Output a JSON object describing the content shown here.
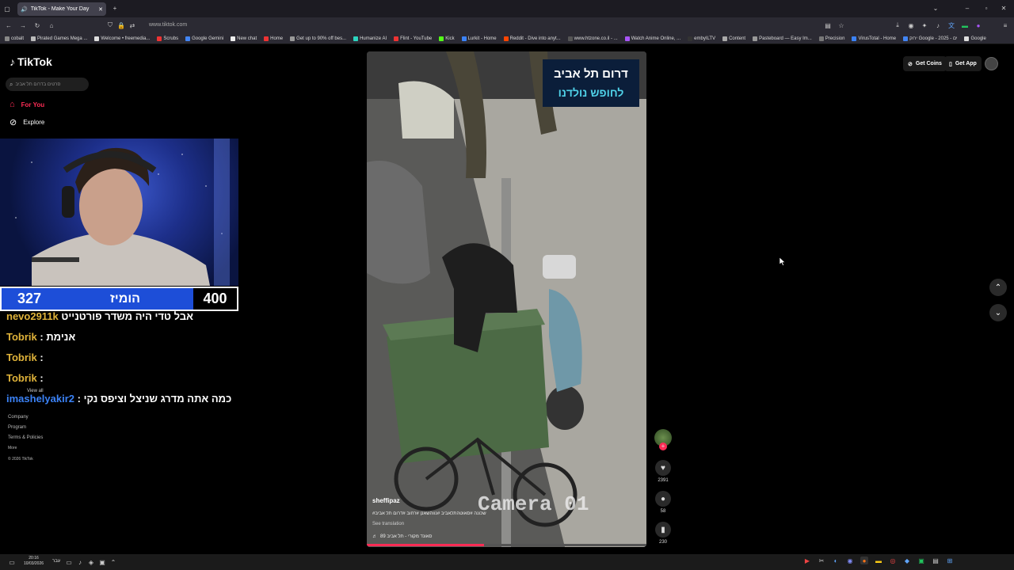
{
  "browser": {
    "tab_title": "TikTok - Make Your Day",
    "url": "www.tiktok.com",
    "bookmarks": [
      {
        "label": "cobalt",
        "color": "#888888"
      },
      {
        "label": "Pirated Games Mega ...",
        "color": "#bbbbbb"
      },
      {
        "label": "Welcome • freemedia...",
        "color": "#dddddd"
      },
      {
        "label": "Scrubs",
        "color": "#e33"
      },
      {
        "label": "Google Gemini",
        "color": "#4285f4"
      },
      {
        "label": "New chat",
        "color": "#eeeeee"
      },
      {
        "label": "Home",
        "color": "#e33"
      },
      {
        "label": "Get up to 90% off bes...",
        "color": "#999999"
      },
      {
        "label": "Humanize AI",
        "color": "#2dd4bf"
      },
      {
        "label": "Flint - YouTube",
        "color": "#e33"
      },
      {
        "label": "Kick",
        "color": "#53fc18"
      },
      {
        "label": "Lurkit - Home",
        "color": "#3b82f6"
      },
      {
        "label": "Reddit - Dive into anyt...",
        "color": "#ff4500"
      },
      {
        "label": "www.htzone.co.il - ...",
        "color": "#555555"
      },
      {
        "label": "Watch Anime Online, ...",
        "color": "#a855f7"
      },
      {
        "label": "embyILTV",
        "color": "#333333"
      },
      {
        "label": "Content",
        "color": "#aaaaaa"
      },
      {
        "label": "Pasteboard — Easy Im...",
        "color": "#999999"
      },
      {
        "label": "Precision",
        "color": "#777777"
      },
      {
        "label": "VirusTotal - Home",
        "color": "#3b82f6"
      },
      {
        "label": "ירוק Google - 2025 - ים",
        "color": "#4285f4"
      },
      {
        "label": "Google",
        "color": "#dddddd"
      }
    ]
  },
  "tiktok": {
    "logo": "TikTok",
    "search_placeholder": "סרטים בדרום תל אביב",
    "nav": [
      {
        "label": "For You",
        "active": true
      },
      {
        "label": "Explore",
        "active": false
      }
    ],
    "footer": [
      "Company",
      "Program",
      "Terms & Policies",
      "More",
      "© 2026 TikTok"
    ],
    "get_coins": "Get Coins",
    "get_app": "Get App"
  },
  "stream": {
    "score_left": "327",
    "score_title": "הומיז",
    "score_right": "400",
    "chat": [
      {
        "user": "nevo2911k",
        "text": "אבל טדי היה משדר פורטנייט",
        "color": "#e0b33a"
      },
      {
        "user": "Tobrik",
        "text": ": אנימת",
        "color": "#e0b33a"
      },
      {
        "user": "Tobrik",
        "text": ":",
        "color": "#e0b33a"
      },
      {
        "user": "Tobrik",
        "text": ":",
        "color": "#e0b33a"
      },
      {
        "user": "imashelyakir2",
        "text": ": כמה אתה מדרג שניצל וציפס נקי",
        "color": "#3b82f6"
      }
    ],
    "view_all": "View all"
  },
  "video": {
    "overlay_line1": "דרום תל אביב",
    "overlay_line2": "לחופש נולדנו",
    "camera_label": "Camera 01",
    "author": "sheffipaz",
    "caption": "#שכונה #סאוטהתלאביב #נווהשאנן #רחוב #דרום תל אביב",
    "see_translation": "See translation",
    "sound": "סאונד מקורי - תל אביב 89",
    "progress": 0.42,
    "likes": "2391",
    "comments": "58",
    "saves": "230"
  },
  "taskbar": {
    "time": "20:16",
    "date": "10/03/2026",
    "lang": "עבר"
  }
}
